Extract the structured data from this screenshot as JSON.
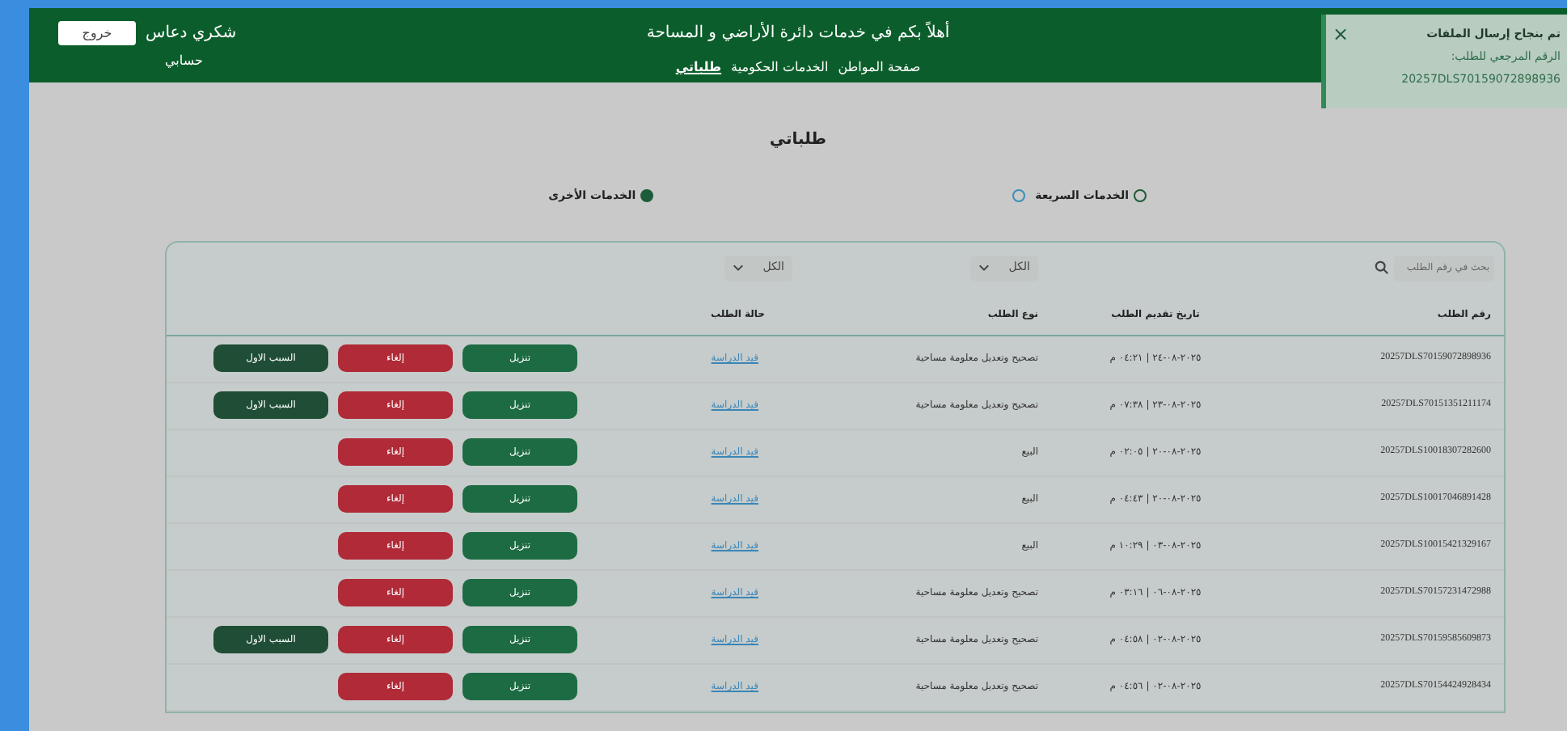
{
  "header": {
    "welcome": "أهلاً بكم في خدمات  دائرة  الأراضي و المساحة",
    "nav": [
      {
        "label": "صفحة المواطن",
        "selected": false
      },
      {
        "label": "الخدمات الحكومية",
        "selected": false
      },
      {
        "label": "طلباتي",
        "selected": true
      }
    ],
    "user_name": "شكري دعاس",
    "logout": "خروج",
    "account": "حسابي"
  },
  "toast": {
    "title": "تم بنجاح إرسال الملفات",
    "reference_label": "الرقم المرجعي للطلب:",
    "reference": "20257DLS70159072898936",
    "close": "×"
  },
  "page_title": "طلباتي",
  "service_options": [
    {
      "label": "الخدمات السريعة",
      "selected": false,
      "info": true
    },
    {
      "label": "الخدمات الأخرى",
      "selected": true,
      "info": false
    }
  ],
  "filters": {
    "search_placeholder": "بحث في رقم الطلب",
    "selects": [
      {
        "value": "الكل"
      },
      {
        "value": "الكل"
      }
    ]
  },
  "table": {
    "columns": [
      "رقم الطلب",
      "تاريخ تقديم الطلب",
      "نوع الطلب",
      "حالة الطلب"
    ],
    "rows": [
      {
        "number": "20257DLS70159072898936",
        "date": "٢٠٢٥-٠٨-٢٤ | ٠٤:٢١ م",
        "type": "تصحيح وتعديل معلومة مساحية",
        "status": "قيد الدراسة",
        "actions": [
          {
            "kind": "download",
            "label": "تنزيل"
          },
          {
            "kind": "cancel",
            "label": "إلغاء"
          },
          {
            "kind": "reason",
            "label": "السبب الاول"
          }
        ]
      },
      {
        "number": "20257DLS70151351211174",
        "date": "٢٠٢٥-٠٨-٢٣ | ٠٧:٣٨ م",
        "type": "تصحيح وتعديل معلومة مساحية",
        "status": "قيد الدراسة",
        "actions": [
          {
            "kind": "download",
            "label": "تنزيل"
          },
          {
            "kind": "cancel",
            "label": "إلغاء"
          },
          {
            "kind": "reason",
            "label": "السبب الاول"
          }
        ]
      },
      {
        "number": "20257DLS10018307282600",
        "date": "٢٠٢٥-٠٨-٢٠ | ٠٢:٠٥ م",
        "type": "البيع",
        "status": "قيد الدراسة",
        "actions": [
          {
            "kind": "download",
            "label": "تنزيل"
          },
          {
            "kind": "cancel",
            "label": "إلغاء"
          }
        ]
      },
      {
        "number": "20257DLS10017046891428",
        "date": "٢٠٢٥-٠٨-٢٠ | ٠٤:٤٣ م",
        "type": "البيع",
        "status": "قيد الدراسة",
        "actions": [
          {
            "kind": "download",
            "label": "تنزيل"
          },
          {
            "kind": "cancel",
            "label": "إلغاء"
          }
        ]
      },
      {
        "number": "20257DLS10015421329167",
        "date": "٢٠٢٥-٠٨-٠٣ | ١٠:٢٩ م",
        "type": "البيع",
        "status": "قيد الدراسة",
        "actions": [
          {
            "kind": "download",
            "label": "تنزيل"
          },
          {
            "kind": "cancel",
            "label": "إلغاء"
          }
        ]
      },
      {
        "number": "20257DLS70157231472988",
        "date": "٢٠٢٥-٠٨-٠٦ | ٠٣:١٦ م",
        "type": "تصحيح وتعديل معلومة مساحية",
        "status": "قيد الدراسة",
        "actions": [
          {
            "kind": "download",
            "label": "تنزيل"
          },
          {
            "kind": "cancel",
            "label": "إلغاء"
          }
        ]
      },
      {
        "number": "20257DLS70159585609873",
        "date": "٢٠٢٥-٠٨-٠٢ | ٠٤:٥٨ م",
        "type": "تصحيح وتعديل معلومة مساحية",
        "status": "قيد الدراسة",
        "actions": [
          {
            "kind": "download",
            "label": "تنزيل"
          },
          {
            "kind": "cancel",
            "label": "إلغاء"
          },
          {
            "kind": "reason",
            "label": "السبب الاول"
          }
        ]
      },
      {
        "number": "20257DLS70154424928434",
        "date": "٢٠٢٥-٠٨-٠٢ | ٠٤:٥٦ م",
        "type": "تصحيح وتعديل معلومة مساحية",
        "status": "قيد الدراسة",
        "actions": [
          {
            "kind": "download",
            "label": "تنزيل"
          },
          {
            "kind": "cancel",
            "label": "إلغاء"
          }
        ]
      }
    ]
  }
}
